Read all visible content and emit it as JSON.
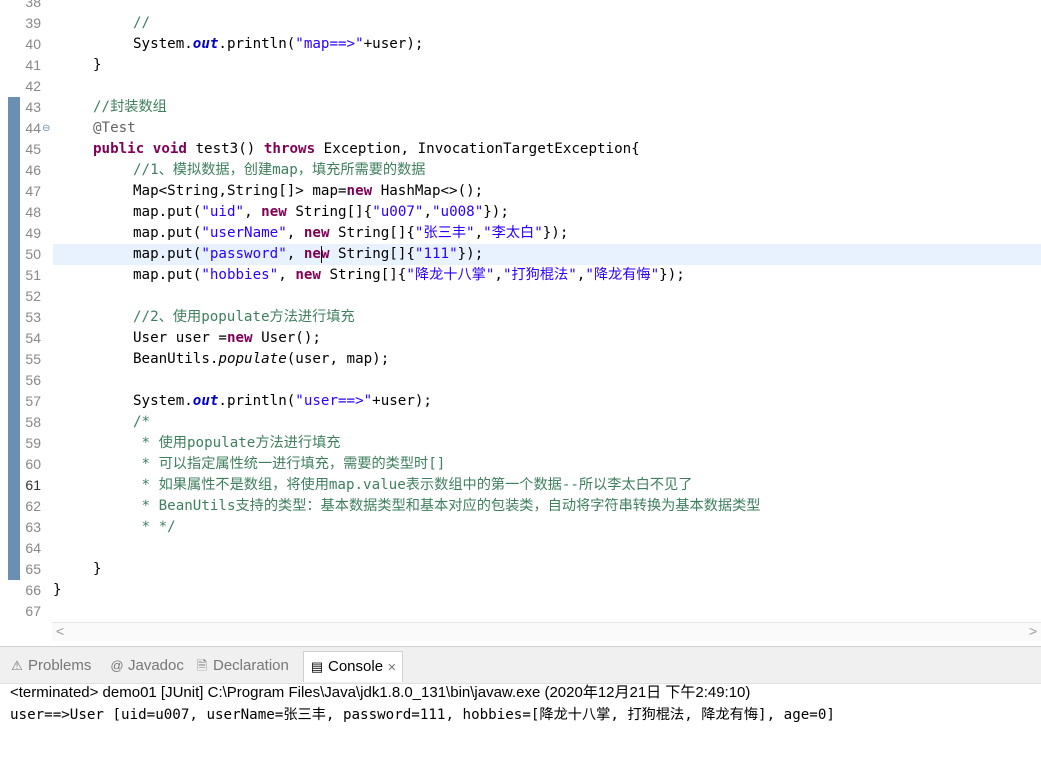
{
  "editor": {
    "line_numbers": [
      "38",
      "39",
      "40",
      "41",
      "42",
      "43",
      "44",
      "45",
      "46",
      "47",
      "48",
      "49",
      "50",
      "51",
      "52",
      "53",
      "54",
      "55",
      "56",
      "57",
      "58",
      "59",
      "60",
      "61",
      "62",
      "63",
      "64",
      "65",
      "66",
      "67"
    ],
    "fold_glyph": "⊖",
    "l39_comment": "//",
    "l40_system": "System.",
    "l40_out": "out",
    "l40_println": ".println(",
    "l40_str": "\"map==>\"",
    "l40_rest": "+user);",
    "l41": "}",
    "l43_comment": "//封装数组",
    "l44_ann": "@Test",
    "l45_kw1": "public",
    "l45_kw2": "void",
    "l45_mid": "test3() ",
    "l45_kw3": "throws",
    "l45_rest": " Exception, InvocationTargetException{",
    "l46_comment": "//1、模拟数据，创建map，填充所需要的数据",
    "l47_a": "Map<String,String[]> map=",
    "l47_new": "new",
    "l47_b": " HashMap<>();",
    "l48_a": "map.put(",
    "l48_s1": "\"uid\"",
    "l48_b": ", ",
    "l48_new": "new",
    "l48_c": " String[]{",
    "l48_s2": "\"u007\"",
    "l48_d": ",",
    "l48_s3": "\"u008\"",
    "l48_e": "});",
    "l49_a": "map.put(",
    "l49_s1": "\"userName\"",
    "l49_b": ", ",
    "l49_new": "new",
    "l49_c": " String[]{",
    "l49_s2": "\"张三丰\"",
    "l49_d": ",",
    "l49_s3": "\"李太白\"",
    "l49_e": "});",
    "l50_a": "map.put(",
    "l50_s1": "\"password\"",
    "l50_b": ", ",
    "l50_new1": "ne",
    "l50_new2": "w",
    "l50_c": " String[]{",
    "l50_s2": "\"111\"",
    "l50_e": "});",
    "l51_a": "map.put(",
    "l51_s1": "\"hobbies\"",
    "l51_b": ", ",
    "l51_new": "new",
    "l51_c": " String[]{",
    "l51_s2": "\"降龙十八掌\"",
    "l51_d1": ",",
    "l51_s3": "\"打狗棍法\"",
    "l51_d2": ",",
    "l51_s4": "\"降龙有悔\"",
    "l51_e": "});",
    "l53_comment": "//2、使用populate方法进行填充",
    "l54_a": "User user =",
    "l54_new": "new",
    "l54_b": " User();",
    "l55_a": "BeanUtils.",
    "l55_m": "populate",
    "l55_b": "(user, map);",
    "l57_system": "System.",
    "l57_out": "out",
    "l57_println": ".println(",
    "l57_str": "\"user==>\"",
    "l57_rest": "+user);",
    "l58": "/*",
    "l59": " * 使用populate方法进行填充",
    "l60": " * 可以指定属性统一进行填充，需要的类型时[]",
    "l61": " * 如果属性不是数组，将使用map.value表示数组中的第一个数据--所以李太白不见了",
    "l62": " * BeanUtils支持的类型：基本数据类型和基本对应的包装类，自动将字符串转换为基本数据类型",
    "l63": " * */",
    "l65": "}",
    "l66": "}"
  },
  "scrollbar": {
    "left_arrow": "<",
    "right_arrow": ">"
  },
  "panel": {
    "tabs": [
      {
        "icon": "⚠",
        "label": "Problems"
      },
      {
        "icon": "@",
        "label": "Javadoc"
      },
      {
        "icon": "🗎",
        "label": "Declaration"
      },
      {
        "icon": "▤",
        "label": "Console",
        "close": "✕"
      }
    ],
    "status": "<terminated> demo01 [JUnit] C:\\Program Files\\Java\\jdk1.8.0_131\\bin\\javaw.exe (2020年12月21日 下午2:49:10)",
    "output": "user==>User [uid=u007, userName=张三丰, password=111, hobbies=[降龙十八掌, 打狗棍法, 降龙有悔], age=0]"
  }
}
